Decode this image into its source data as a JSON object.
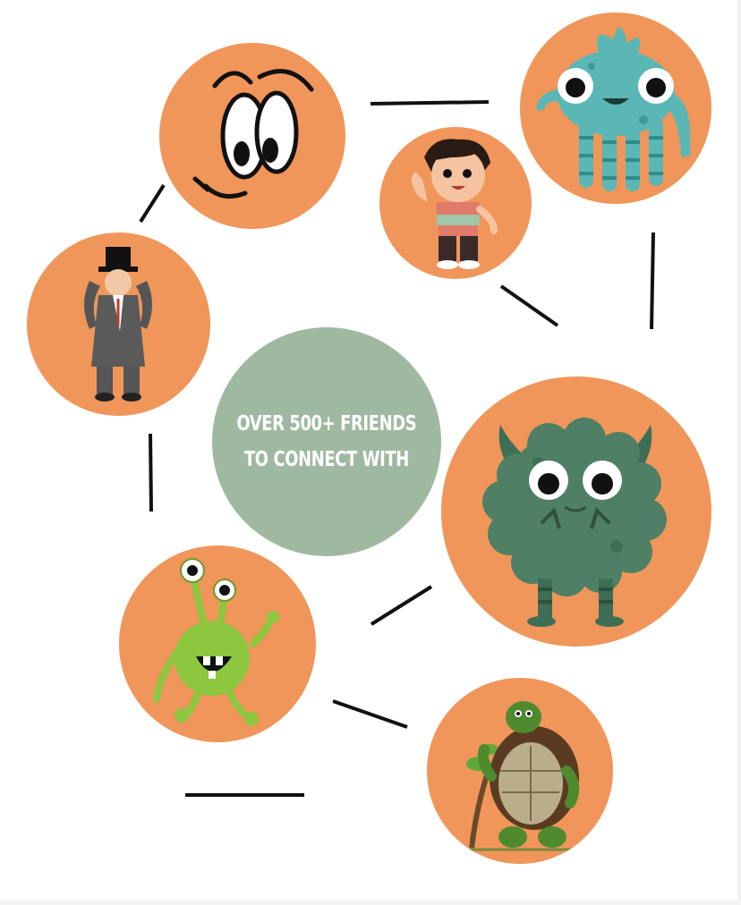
{
  "center": {
    "line1": "OVER 500+ FRIENDS",
    "line2": "TO CONNECT WITH"
  },
  "colors": {
    "bubble": "#f0965a",
    "center_bubble": "#9fb9a1",
    "connector": "#111111",
    "background": "#ffffff"
  },
  "characters": [
    {
      "name": "cartoon-eyes-face",
      "icon": "cartoon-face-icon"
    },
    {
      "name": "teal-monster",
      "icon": "teal-monster-icon"
    },
    {
      "name": "waving-boy",
      "icon": "waving-boy-icon"
    },
    {
      "name": "top-hat-gentleman",
      "icon": "gentleman-icon"
    },
    {
      "name": "green-fuzzy-monster",
      "icon": "fuzzy-monster-icon"
    },
    {
      "name": "green-alien",
      "icon": "alien-icon"
    },
    {
      "name": "tortoise",
      "icon": "tortoise-icon"
    }
  ]
}
